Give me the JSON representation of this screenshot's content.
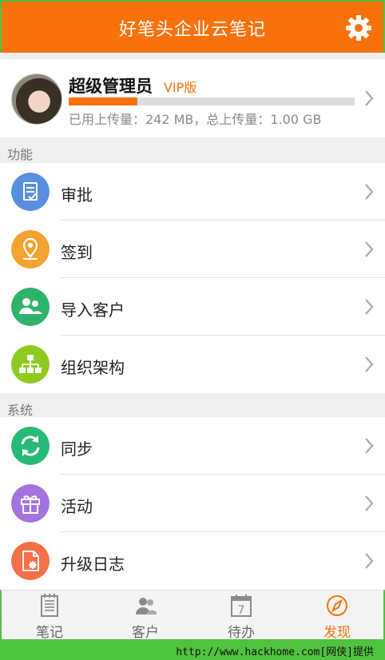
{
  "header": {
    "title": "好笔头企业云笔记",
    "settings_icon": "gear-icon"
  },
  "profile": {
    "name": "超级管理员",
    "badge": "VIP版",
    "usage_fraction": 0.24,
    "usage_text": "已用上传量：242 MB，总上传量：1.00 GB"
  },
  "sections": {
    "features": "功能",
    "system": "系统"
  },
  "features": [
    {
      "label": "审批",
      "icon": "approval-doc-icon",
      "color": "#5a8fe0"
    },
    {
      "label": "签到",
      "icon": "location-pin-icon",
      "color": "#f4a232"
    },
    {
      "label": "导入客户",
      "icon": "contacts-icon",
      "color": "#2fb36a"
    },
    {
      "label": "组织架构",
      "icon": "org-chart-icon",
      "color": "#8fca1f"
    }
  ],
  "system": [
    {
      "label": "同步",
      "icon": "sync-icon",
      "color": "#28b977"
    },
    {
      "label": "活动",
      "icon": "gift-icon",
      "color": "#a672dd"
    },
    {
      "label": "升级日志",
      "icon": "upgrade-log-icon",
      "color": "#f56f48"
    }
  ],
  "tabs": [
    {
      "label": "笔记",
      "icon": "notebook-icon",
      "active": false
    },
    {
      "label": "客户",
      "icon": "customers-icon",
      "active": false
    },
    {
      "label": "待办",
      "icon": "calendar-icon",
      "active": false,
      "icon_text": "7"
    },
    {
      "label": "发现",
      "icon": "compass-icon",
      "active": true
    }
  ],
  "accent_color": "#f8720c",
  "watermark": "http://www.hackhome.com[网侠]提供"
}
